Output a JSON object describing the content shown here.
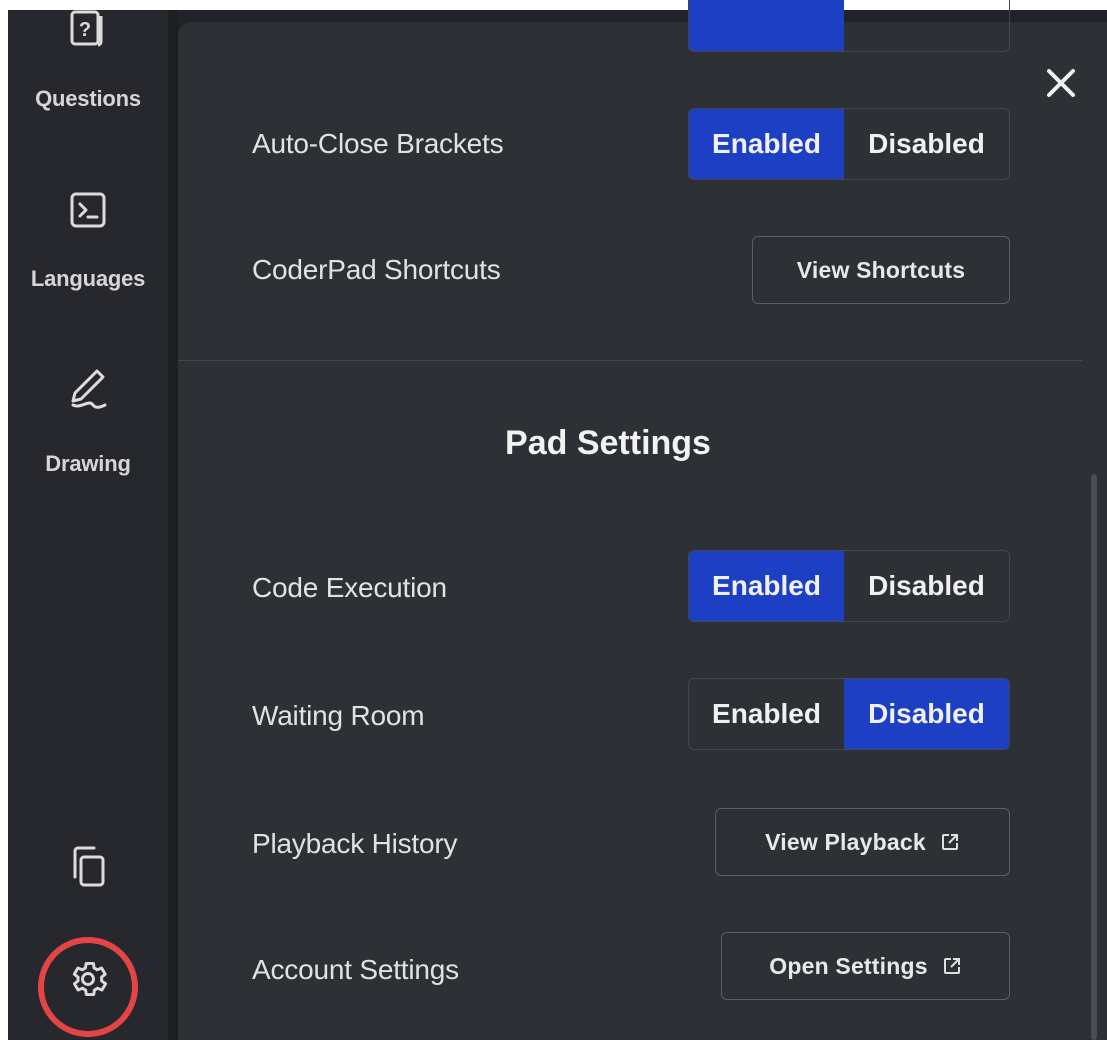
{
  "sidebar": {
    "items": [
      {
        "label": "Questions",
        "icon": "question-card-icon"
      },
      {
        "label": "Languages",
        "icon": "terminal-icon"
      },
      {
        "label": "Drawing",
        "icon": "pen-icon"
      }
    ],
    "bottom_icons": [
      "copy-icon",
      "gear-icon"
    ]
  },
  "panel": {
    "close_icon": "close-icon",
    "editor_rows": [
      {
        "label": "Auto-Close Brackets",
        "enabled_label": "Enabled",
        "disabled_label": "Disabled",
        "value": "Enabled"
      }
    ],
    "shortcuts": {
      "label": "CoderPad Shortcuts",
      "button": "View Shortcuts"
    },
    "pad_settings": {
      "title": "Pad Settings",
      "code_execution": {
        "label": "Code Execution",
        "enabled_label": "Enabled",
        "disabled_label": "Disabled",
        "value": "Enabled"
      },
      "waiting_room": {
        "label": "Waiting Room",
        "enabled_label": "Enabled",
        "disabled_label": "Disabled",
        "value": "Disabled"
      },
      "playback": {
        "label": "Playback History",
        "button": "View Playback"
      },
      "account": {
        "label": "Account Settings",
        "button": "Open Settings"
      }
    }
  },
  "colors": {
    "accent": "#1c3fc4",
    "highlight": "#e34545",
    "panel_bg": "#2d3035",
    "sidebar_bg": "#26282d"
  }
}
